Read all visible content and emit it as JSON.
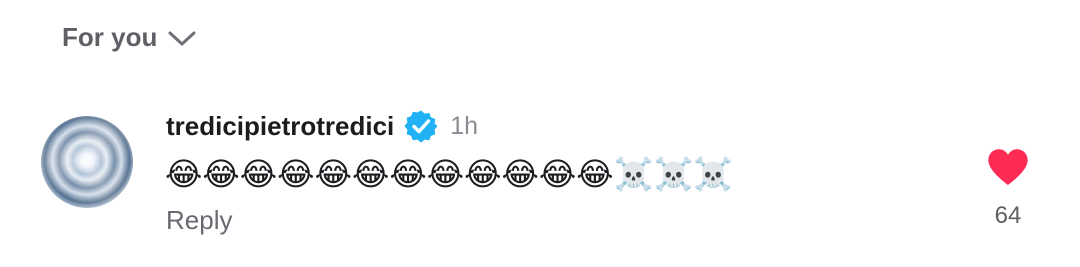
{
  "sort": {
    "label": "For you"
  },
  "comment": {
    "username": "tredicipietrotredici",
    "verified": true,
    "timestamp": "1h",
    "text": "😂😂😂😂😂😂😂😂😂😂😂😂☠️☠️☠️",
    "reply_label": "Reply",
    "like_count": "64",
    "liked": true
  },
  "colors": {
    "like": "#fe2c55",
    "verified": "#20b2f5",
    "muted_text": "#686a70"
  },
  "icons": {
    "sort_toggle": "chevron-down-icon",
    "verified": "verified-badge-icon",
    "like": "heart-icon"
  }
}
